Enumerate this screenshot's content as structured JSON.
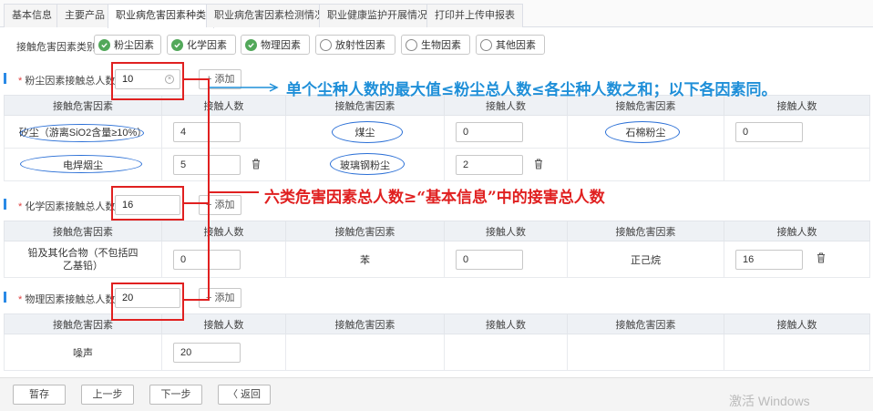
{
  "tabs": [
    "基本信息",
    "主要产品",
    "职业病危害因素种类",
    "职业病危害因素检测情况",
    "职业健康监护开展情况",
    "打印并上传申报表"
  ],
  "category_row": {
    "label": "接触危害因素类别:",
    "chips": [
      {
        "label": "粉尘因素",
        "checked": true
      },
      {
        "label": "化学因素",
        "checked": true
      },
      {
        "label": "物理因素",
        "checked": true
      },
      {
        "label": "放射性因素",
        "checked": false
      },
      {
        "label": "生物因素",
        "checked": false
      },
      {
        "label": "其他因素",
        "checked": false
      }
    ]
  },
  "add_label": "+ 添加",
  "table_headers": {
    "factor": "接触危害因素",
    "count": "接触人数"
  },
  "dust": {
    "label": "粉尘因素接触总人数:",
    "total": "10",
    "rows": [
      [
        {
          "name": "矽尘（游离SiO2含量≥10%）",
          "count": "4"
        },
        {
          "name": "煤尘",
          "count": "0"
        },
        {
          "name": "石棉粉尘",
          "count": "0"
        }
      ],
      [
        {
          "name": "电焊烟尘",
          "count": "5"
        },
        {
          "name": "玻璃钢粉尘",
          "count": "2"
        }
      ]
    ]
  },
  "chemical": {
    "label": "化学因素接触总人数:",
    "total": "16",
    "rows": [
      [
        {
          "name": "铅及其化合物（不包括四乙基铅）",
          "count": "0"
        },
        {
          "name": "苯",
          "count": "0"
        },
        {
          "name": "正己烷",
          "count": "16"
        }
      ]
    ]
  },
  "physical": {
    "label": "物理因素接触总人数:",
    "total": "20",
    "rows": [
      [
        {
          "name": "噪声",
          "count": "20"
        }
      ]
    ]
  },
  "annotations": {
    "blue_note": "单个尘种人数的最大值≤粉尘总人数≤各尘种人数之和；以下各因素同。",
    "red_note": "六类危害因素总人数≥“基本信息”中的接害总人数"
  },
  "footer": {
    "buttons": [
      "暂存",
      "上一步",
      "下一步",
      "〈 返回"
    ],
    "watermark": "激活 Windows"
  },
  "colors": {
    "accent_blue": "#2a8ae6",
    "checked_green": "#52a85a",
    "annotation_red": "#e02020",
    "annotation_blue": "#1f8fd8"
  }
}
